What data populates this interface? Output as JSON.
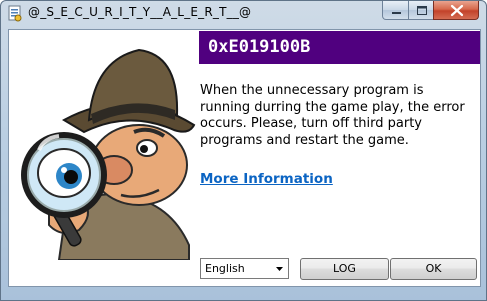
{
  "window": {
    "title": "@_S_E_C_U_R_I_T_Y__A_L_E_R_T__@"
  },
  "dialog": {
    "error_code": "0xE019100B",
    "message": "When the unnecessary program is running durring the game play, the error occurs. Please, turn off third party programs and restart the game.",
    "more_info_link": "More Information",
    "language": {
      "selected": "English"
    },
    "buttons": {
      "log": "LOG",
      "ok": "OK"
    }
  },
  "colors": {
    "banner": "#50007f",
    "link": "#0b64c3",
    "close_button": "#c3422a"
  },
  "icons": [
    "app-document-icon",
    "minimize-icon",
    "maximize-icon",
    "close-icon",
    "detective-illustration",
    "dropdown-arrow-icon"
  ]
}
